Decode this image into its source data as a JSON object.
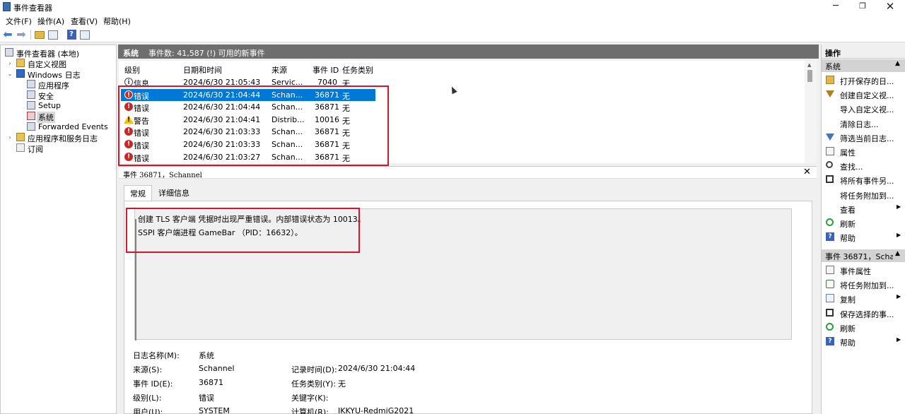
{
  "window": {
    "title": "事件查看器",
    "minimize_glyph": "─",
    "maximize_glyph": "❐",
    "close_glyph": "✕"
  },
  "menu": [
    "文件(F)",
    "操作(A)",
    "查看(V)",
    "帮助(H)"
  ],
  "toolbar": {
    "back_icon": "back-arrow-icon",
    "forward_icon": "forward-arrow-icon",
    "back_glyph": "⬅",
    "forward_glyph": "➡",
    "help_glyph": "?"
  },
  "tree": {
    "root": "事件查看器 (本地)",
    "custom_views": "自定义视图",
    "windows_logs": "Windows 日志",
    "application": "应用程序",
    "security": "安全",
    "setup": "Setup",
    "system": "系统",
    "forwarded": "Forwarded Events",
    "app_service_logs": "应用程序和服务日志",
    "subscriptions": "订阅",
    "expanded_glyph": "⌄",
    "collapsed_glyph": "›"
  },
  "center": {
    "title": "系统",
    "count": "事件数: 41,587 (!) 可用的新事件"
  },
  "columns": {
    "level": "级别",
    "datetime": "日期和时间",
    "source": "来源",
    "event_id": "事件 ID",
    "task": "任务类别"
  },
  "events": [
    {
      "level": "信息",
      "type": "info",
      "datetime": "2024/6/30 21:05:43",
      "source": "Servic...",
      "id": "7040",
      "task": "无"
    },
    {
      "level": "错误",
      "type": "error",
      "datetime": "2024/6/30 21:04:44",
      "source": "Schan...",
      "id": "36871",
      "task": "无"
    },
    {
      "level": "错误",
      "type": "error",
      "datetime": "2024/6/30 21:04:44",
      "source": "Schan...",
      "id": "36871",
      "task": "无"
    },
    {
      "level": "警告",
      "type": "warning",
      "datetime": "2024/6/30 21:04:41",
      "source": "Distrib...",
      "id": "10016",
      "task": "无"
    },
    {
      "level": "错误",
      "type": "error",
      "datetime": "2024/6/30 21:03:33",
      "source": "Schan...",
      "id": "36871",
      "task": "无"
    },
    {
      "level": "错误",
      "type": "error",
      "datetime": "2024/6/30 21:03:33",
      "source": "Schan...",
      "id": "36871",
      "task": "无"
    },
    {
      "level": "错误",
      "type": "error",
      "datetime": "2024/6/30 21:03:27",
      "source": "Schan...",
      "id": "36871",
      "task": "无"
    }
  ],
  "selected_event_index": 1,
  "level_glyphs": {
    "info": "i",
    "error": "!",
    "warning": "!"
  },
  "scroll_glyph": "▲",
  "detail": {
    "title": "事件 36871，Schannel",
    "close_glyph": "✕",
    "tab_general": "常规",
    "tab_details": "详细信息",
    "desc_line1": "创建 TLS 客户端 凭据时出现严重错误。内部错误状态为 10013。",
    "desc_line2": "SSPI 客户端进程 GameBar （PID：16632）。",
    "fields": {
      "log_name_label": "日志名称(M):",
      "log_name": "系统",
      "source_label": "来源(S):",
      "source": "Schannel",
      "logged_label": "记录时间(D):",
      "logged": "2024/6/30 21:04:44",
      "event_id_label": "事件 ID(E):",
      "event_id": "36871",
      "task_label": "任务类别(Y):",
      "task": "无",
      "level_label": "级别(L):",
      "level": "错误",
      "keywords_label": "关键字(K):",
      "keywords": "",
      "user_label": "用户(U):",
      "user": "SYSTEM",
      "computer_label": "计算机(R):",
      "computer": "IKKYU-RedmiG2021"
    }
  },
  "actions": {
    "title": "操作",
    "section1": "系统",
    "section1_items": [
      {
        "label": "打开保存的日...",
        "icon": "folder"
      },
      {
        "label": "创建自定义视...",
        "icon": "filter"
      },
      {
        "label": "导入自定义视...",
        "icon": "none"
      },
      {
        "label": "清除日志...",
        "icon": "none"
      },
      {
        "label": "筛选当前日志...",
        "icon": "filter-blue"
      },
      {
        "label": "属性",
        "icon": "prop"
      },
      {
        "label": "查找...",
        "icon": "find"
      },
      {
        "label": "将所有事件另...",
        "icon": "save"
      },
      {
        "label": "将任务附加到...",
        "icon": "none"
      },
      {
        "label": "查看",
        "icon": "none",
        "submenu": true
      },
      {
        "label": "刷新",
        "icon": "refresh"
      },
      {
        "label": "帮助",
        "icon": "help",
        "submenu": true
      }
    ],
    "section2": "事件 36871，Scha...",
    "section2_items": [
      {
        "label": "事件属性",
        "icon": "prop"
      },
      {
        "label": "将任务附加到...",
        "icon": "task"
      },
      {
        "label": "复制",
        "icon": "copy",
        "submenu": true
      },
      {
        "label": "保存选择的事...",
        "icon": "save"
      },
      {
        "label": "刷新",
        "icon": "refresh"
      },
      {
        "label": "帮助",
        "icon": "help",
        "submenu": true
      }
    ],
    "collapse_glyph": "▲",
    "submenu_glyph": "▶",
    "help_glyph": "?"
  },
  "colors": {
    "selection": "#0078d7",
    "error": "#c62828",
    "warning": "#f2c200",
    "annotation": "#d8142a"
  }
}
